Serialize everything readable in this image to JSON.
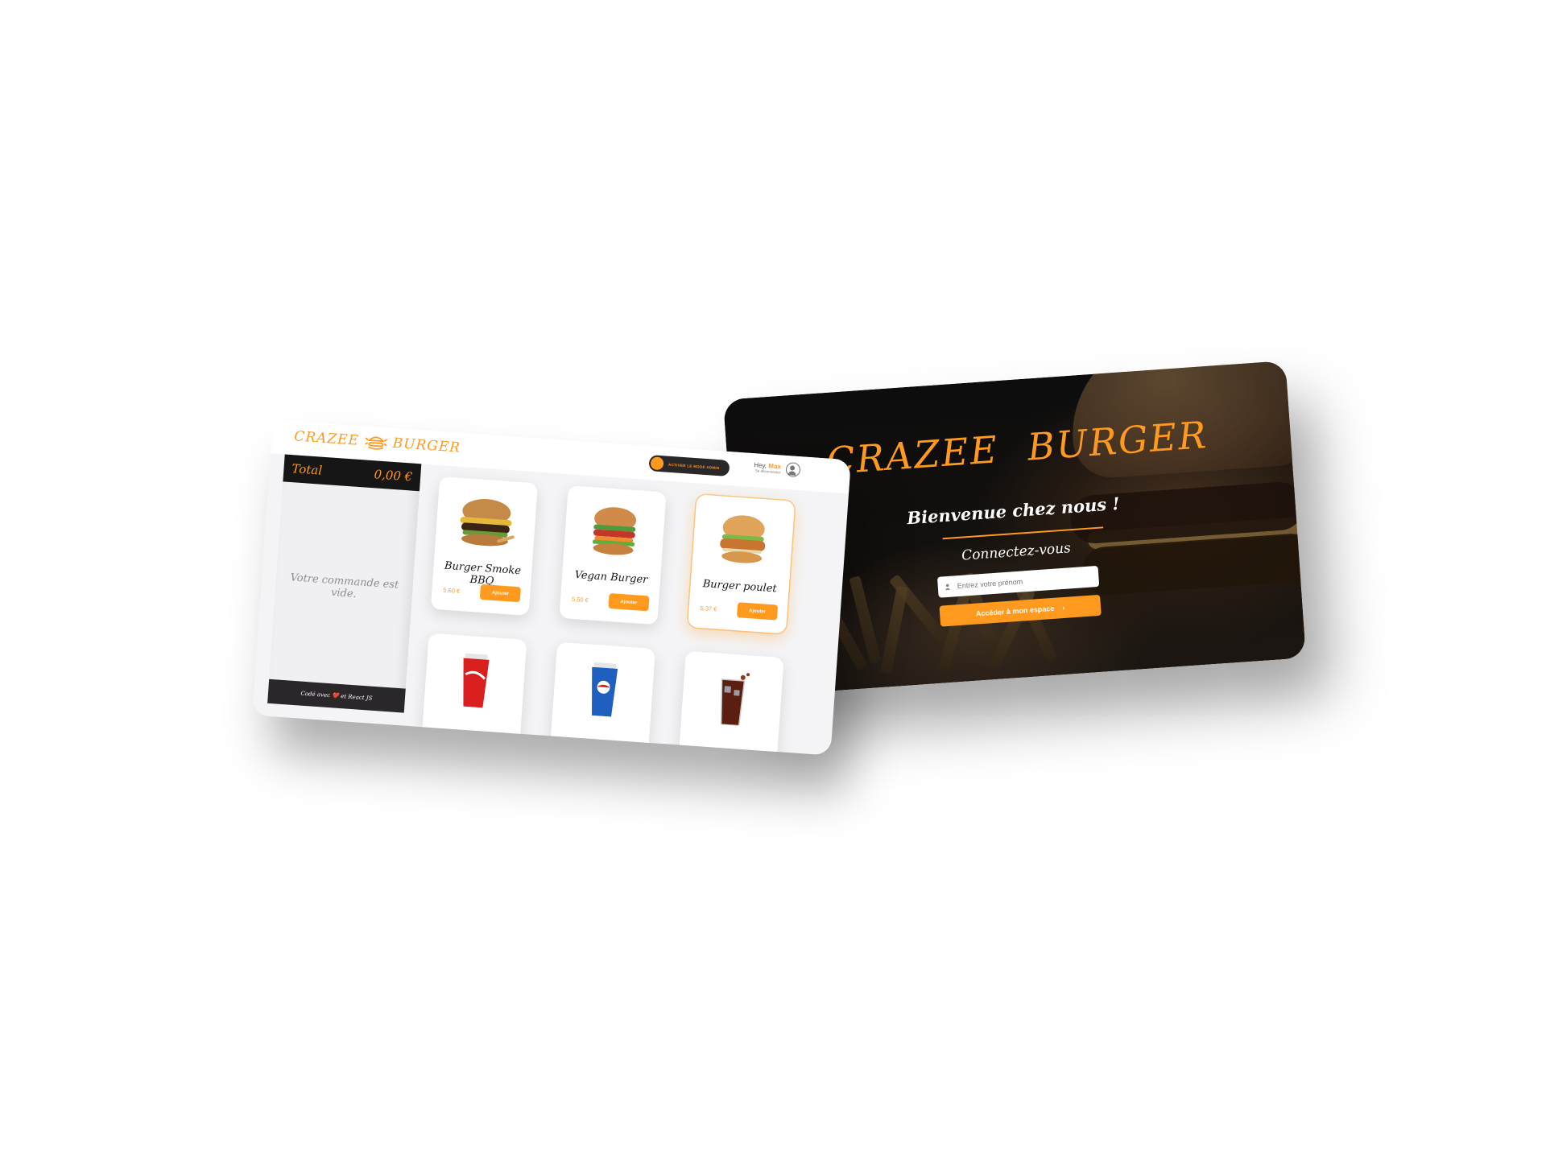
{
  "brand": {
    "word_left": "CRAZEE",
    "word_right": "BURGER",
    "accent_color": "#ff9a1f",
    "logo_icon": "burger-logo-icon"
  },
  "login": {
    "welcome": "Bienvenue chez nous !",
    "subtitle": "Connectez-vous",
    "input_placeholder": "Entrez votre prénom",
    "input_icon": "user-icon",
    "submit_label": "Accéder à mon espace",
    "submit_icon": "chevron-right-icon"
  },
  "app": {
    "admin_toggle_label": "ACTIVER LE MODE ADMIN",
    "greeting_prefix": "Hey,",
    "username": "Max",
    "logout_label": "Se déconnecter",
    "basket": {
      "total_label": "Total",
      "total_value": "0,00 €",
      "empty_message": "Votre commande est vide.",
      "footer": "Codé avec ❤️ et React JS"
    },
    "menu": [
      {
        "name": "Burger Smoke BBQ",
        "price": "5,60 €",
        "button": "Ajouter",
        "image": "burger-image"
      },
      {
        "name": "Vegan Burger",
        "price": "5,50 €",
        "button": "Ajouter",
        "image": "vegan-burger-image"
      },
      {
        "name": "Burger poulet",
        "price": "5,37 €",
        "button": "Ajouter",
        "image": "chicken-burger-image"
      },
      {
        "name": "",
        "price": "",
        "button": "",
        "image": "coca-cola-cup-image"
      },
      {
        "name": "",
        "price": "",
        "button": "",
        "image": "pepsi-cup-image"
      },
      {
        "name": "",
        "price": "",
        "button": "",
        "image": "iced-soda-glass-image"
      }
    ]
  }
}
